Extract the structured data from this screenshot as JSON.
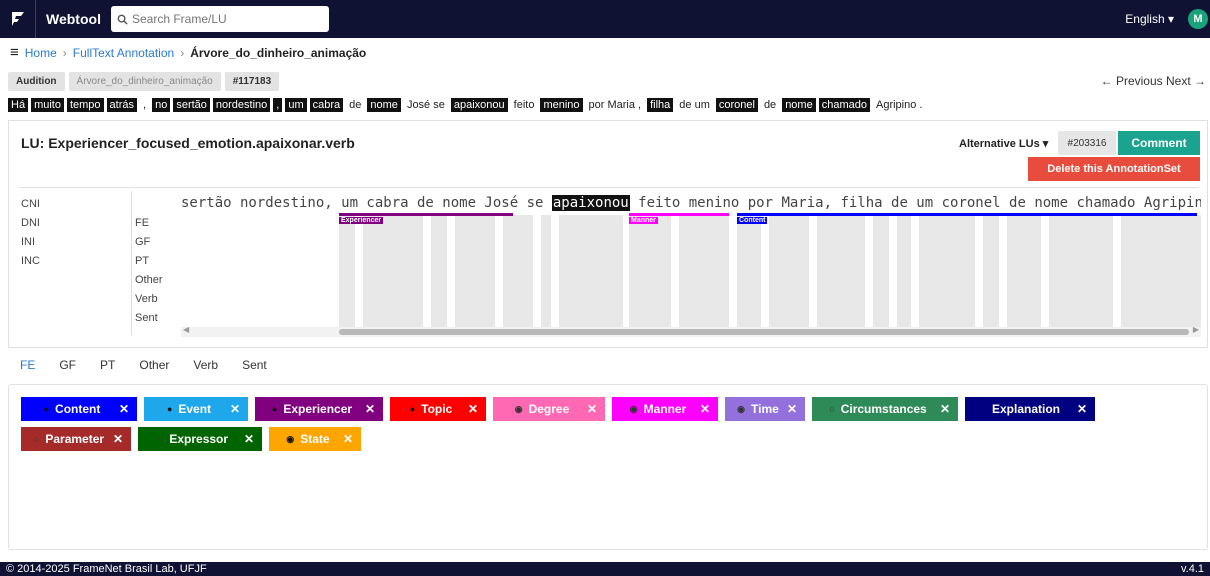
{
  "header": {
    "brand": "Webtool",
    "search_placeholder": "Search Frame/LU",
    "language": "English ▾",
    "avatar_initial": "M"
  },
  "breadcrumb": {
    "menu_icon": "≡",
    "home": "Home",
    "section": "FullText Annotation",
    "current": "Árvore_do_dinheiro_animação"
  },
  "tags": {
    "corpus": "Audition",
    "document": "Árvore_do_dinheiro_animação",
    "sentence_id": "#117183"
  },
  "nav": {
    "prev_next": "← Previous Next →"
  },
  "sentence_tokens": [
    {
      "text": "Há",
      "hl": true
    },
    {
      "text": "muito",
      "hl": true
    },
    {
      "text": "tempo",
      "hl": true
    },
    {
      "text": "atrás",
      "hl": true
    },
    {
      "text": ",",
      "hl": false
    },
    {
      "text": "no",
      "hl": true
    },
    {
      "text": "sertão",
      "hl": true
    },
    {
      "text": "nordestino",
      "hl": true
    },
    {
      "text": ",",
      "hl": true
    },
    {
      "text": "um",
      "hl": true
    },
    {
      "text": "cabra",
      "hl": true
    },
    {
      "text": "de",
      "hl": false
    },
    {
      "text": "nome",
      "hl": true
    },
    {
      "text": "José se",
      "hl": false
    },
    {
      "text": "apaixonou",
      "hl": true
    },
    {
      "text": "feito",
      "hl": false
    },
    {
      "text": "menino",
      "hl": true
    },
    {
      "text": "por Maria ,",
      "hl": false
    },
    {
      "text": "filha",
      "hl": true
    },
    {
      "text": "de um",
      "hl": false
    },
    {
      "text": "coronel",
      "hl": true
    },
    {
      "text": "de",
      "hl": false
    },
    {
      "text": "nome",
      "hl": true
    },
    {
      "text": "chamado",
      "hl": true
    },
    {
      "text": "Agripino .",
      "hl": false
    }
  ],
  "lu": {
    "title": "LU: Experiencer_focused_emotion.apaixonar.verb",
    "alt_label": "Alternative LUs ▾",
    "annotation_id": "#203316",
    "comment_button": "Comment",
    "delete_button": "Delete this AnnotationSet"
  },
  "layers_left": [
    "CNI",
    "DNI",
    "INI",
    "INC"
  ],
  "layers_right": [
    "FE",
    "GF",
    "PT",
    "Other",
    "Verb",
    "Sent"
  ],
  "annotated": {
    "before": "sertão nordestino, um cabra de nome José se ",
    "target": "apaixonou",
    "after": " feito menino por Maria, filha de um coronel de nome chamado Agripino."
  },
  "fe_marks": [
    {
      "label": "Experiencer",
      "color": "#800080"
    },
    {
      "label": "Manner",
      "color": "#ff00ff"
    },
    {
      "label": "Content",
      "color": "#0000ff"
    }
  ],
  "bottom_tabs": [
    "FE",
    "GF",
    "PT",
    "Other",
    "Verb",
    "Sent"
  ],
  "fe_buttons": [
    {
      "label": "Content",
      "bg": "#0000ff",
      "fg": "#ffffff",
      "dot": "●",
      "dotcolor": "#111"
    },
    {
      "label": "Event",
      "bg": "#1ea7ea",
      "fg": "#ffffff",
      "dot": "●",
      "dotcolor": "#111"
    },
    {
      "label": "Experiencer",
      "bg": "#800080",
      "fg": "#ffffff",
      "dot": "●",
      "dotcolor": "#111"
    },
    {
      "label": "Topic",
      "bg": "#ff0000",
      "fg": "#ffffff",
      "dot": "●",
      "dotcolor": "#111"
    },
    {
      "label": "Degree",
      "bg": "#ff69b4",
      "fg": "#ffffff",
      "dot": "◉",
      "dotcolor": "#333"
    },
    {
      "label": "Manner",
      "bg": "#ff00ff",
      "fg": "#ffffff",
      "dot": "◉",
      "dotcolor": "#333"
    },
    {
      "label": "Time",
      "bg": "#9370db",
      "fg": "#ffffff",
      "dot": "◉",
      "dotcolor": "#333"
    },
    {
      "label": "Circumstances",
      "bg": "#2e8b57",
      "fg": "#ffffff",
      "dot": "○",
      "dotcolor": "#333"
    },
    {
      "label": "Explanation",
      "bg": "#000080",
      "fg": "#ffffff",
      "dot": "",
      "dotcolor": "#333"
    },
    {
      "label": "Parameter",
      "bg": "#a52a2a",
      "fg": "#ffffff",
      "dot": "○",
      "dotcolor": "#333"
    },
    {
      "label": "Expressor",
      "bg": "#006400",
      "fg": "#ffffff",
      "dot": "○",
      "dotcolor": "#333"
    },
    {
      "label": "State",
      "bg": "#ffa500",
      "fg": "#ffffff",
      "dot": "◉",
      "dotcolor": "#111"
    }
  ],
  "footer": {
    "copyright": "© 2014-2025 FrameNet Brasil Lab, UFJF",
    "version": "v.4.1"
  }
}
